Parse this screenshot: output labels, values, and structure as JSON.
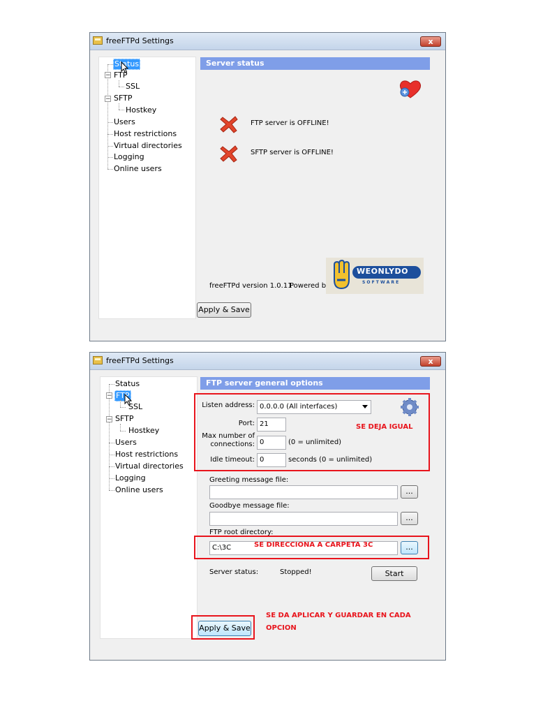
{
  "window1": {
    "title": "freeFTPd Settings",
    "close": "x",
    "tree": {
      "status": "Status",
      "ftp": "FTP",
      "ssl": "SSL",
      "sftp": "SFTP",
      "hostkey": "Hostkey",
      "users": "Users",
      "host_restrictions": "Host restrictions",
      "virtual_directories": "Virtual directories",
      "logging": "Logging",
      "online_users": "Online users"
    },
    "header": "Server status",
    "ftp_status": "FTP server is OFFLINE!",
    "sftp_status": "SFTP server is OFFLINE!",
    "version": "freeFTPd version 1.0.11",
    "powered_by": "Powered by",
    "logo_text": "WEONLYDO",
    "logo_sub": "S O F T W A R E",
    "apply_save": "Apply & Save"
  },
  "window2": {
    "title": "freeFTPd Settings",
    "close": "x",
    "tree": {
      "status": "Status",
      "ftp": "FTP",
      "ssl": "SSL",
      "sftp": "SFTP",
      "hostkey": "Hostkey",
      "users": "Users",
      "host_restrictions": "Host restrictions",
      "virtual_directories": "Virtual directories",
      "logging": "Logging",
      "online_users": "Online users"
    },
    "header": "FTP server general options",
    "listen_label": "Listen address:",
    "listen_value": "0.0.0.0 (All interfaces)",
    "port_label": "Port:",
    "port_value": "21",
    "maxconn_label_1": "Max number of",
    "maxconn_label_2": "connections:",
    "maxconn_value": "0",
    "maxconn_hint": "(0 = unlimited)",
    "idle_label": "Idle timeout:",
    "idle_value": "0",
    "idle_hint": "seconds (0 = unlimited)",
    "greeting_label": "Greeting message file:",
    "greeting_value": "",
    "goodbye_label": "Goodbye message file:",
    "goodbye_value": "",
    "root_label": "FTP root directory:",
    "root_value": "C:\\3C",
    "browse": "...",
    "server_status_label": "Server status:",
    "server_status_value": "Stopped!",
    "start": "Start",
    "apply_save": "Apply & Save"
  },
  "annotations": {
    "same": "SE DEJA IGUAL",
    "folder": "SE DIRECCIONA A CARPETA 3C",
    "apply_1": "SE DA APLICAR  Y GUARDAR EN CADA",
    "apply_2": "OPCION"
  },
  "colors": {
    "header_bar": "#7f9ee8",
    "selection": "#3399ff",
    "annotation_red": "#e8141c"
  }
}
